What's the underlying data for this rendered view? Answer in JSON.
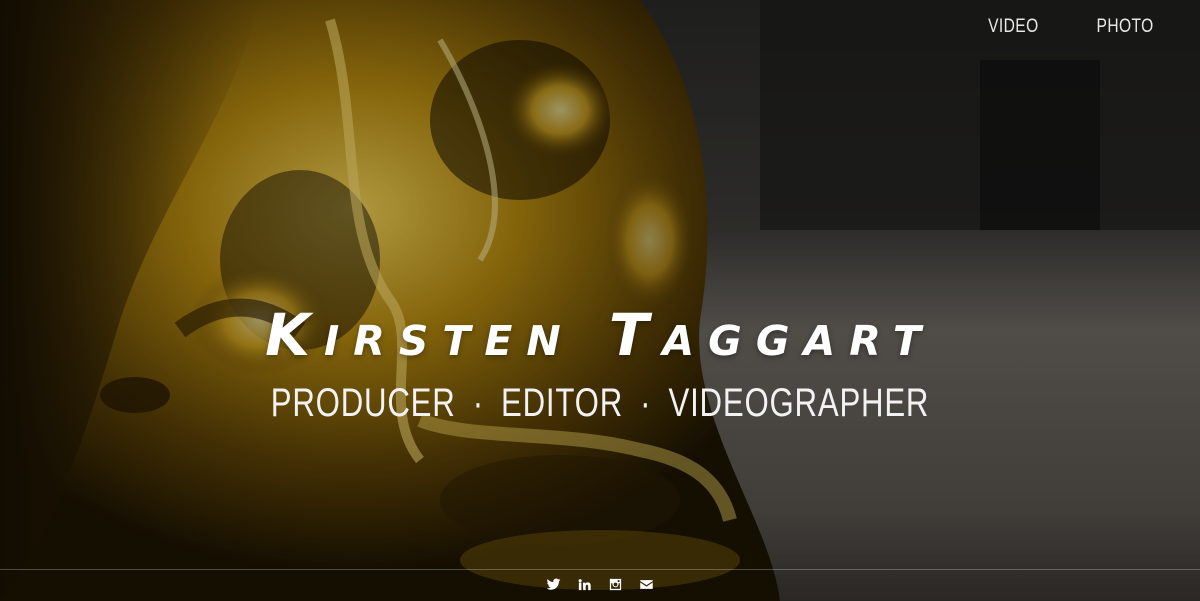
{
  "nav": {
    "items": [
      {
        "label": "VIDEO"
      },
      {
        "label": "PHOTO"
      }
    ]
  },
  "hero": {
    "title": "Kirsten Taggart",
    "subtitle": {
      "parts": [
        "PRODUCER",
        "EDITOR",
        "VIDEOGRAPHER"
      ],
      "separator": "·"
    },
    "background": "gold-skull-photo"
  },
  "social": {
    "icons": [
      "twitter-icon",
      "linkedin-icon",
      "instagram-icon",
      "email-icon"
    ]
  },
  "colors": {
    "text": "#ffffff",
    "gold": "#c9a21c",
    "dark": "#0b0905"
  }
}
